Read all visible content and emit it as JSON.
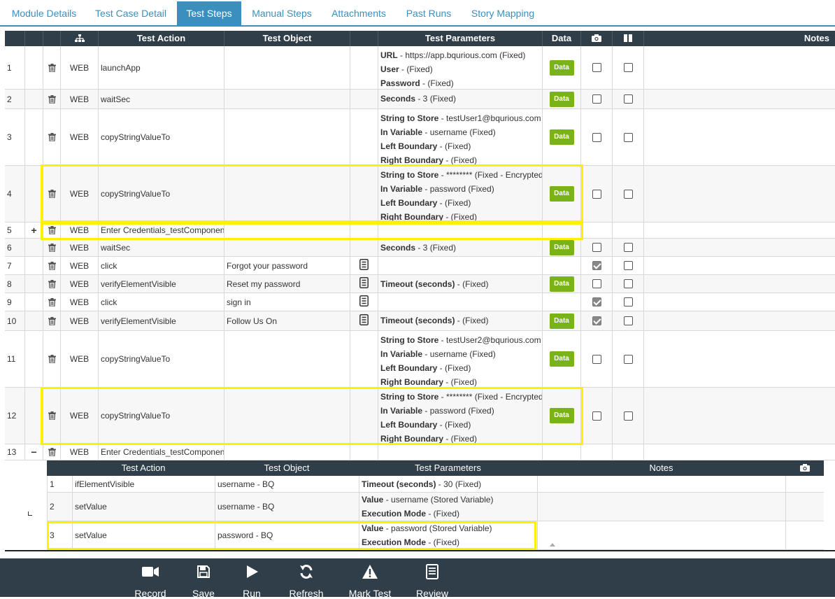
{
  "tabs": [
    {
      "label": "Module Details"
    },
    {
      "label": "Test Case Detail"
    },
    {
      "label": "Test Steps"
    },
    {
      "label": "Manual Steps"
    },
    {
      "label": "Attachments"
    },
    {
      "label": "Past Runs"
    },
    {
      "label": "Story Mapping"
    }
  ],
  "active_tab": "Test Steps",
  "main_table": {
    "headers": {
      "action": "Test Action",
      "object": "Test Object",
      "params": "Test Parameters",
      "data": "Data",
      "notes": "Notes"
    },
    "data_button_label": "Data",
    "rows": [
      {
        "num": "1",
        "expand": "",
        "platform": "WEB",
        "action": "launchApp",
        "object": "",
        "has_obj_icon": false,
        "params": [
          {
            "k": "URL",
            "v": " - https://app.bqurious.com (Fixed)"
          },
          {
            "k": "User",
            "v": " -  (Fixed)"
          },
          {
            "k": "Password",
            "v": " -  (Fixed)"
          }
        ],
        "data": true,
        "cb1": false,
        "cb2": false
      },
      {
        "num": "2",
        "expand": "",
        "platform": "WEB",
        "action": "waitSec",
        "object": "",
        "has_obj_icon": false,
        "params": [
          {
            "k": "Seconds",
            "v": " - 3 (Fixed)"
          }
        ],
        "data": true,
        "cb1": false,
        "cb2": false
      },
      {
        "num": "3",
        "expand": "",
        "platform": "WEB",
        "action": "copyStringValueTo",
        "object": "",
        "has_obj_icon": false,
        "params": [
          {
            "k": "String to Store",
            "v": " - testUser1@bqurious.com"
          },
          {
            "k": "In Variable",
            "v": " - username (Fixed)"
          },
          {
            "k": "Left Boundary",
            "v": " -  (Fixed)"
          },
          {
            "k": "Right Boundary",
            "v": " -  (Fixed)"
          }
        ],
        "data": true,
        "cb1": false,
        "cb2": false
      },
      {
        "num": "4",
        "expand": "",
        "platform": "WEB",
        "action": "copyStringValueTo",
        "object": "",
        "has_obj_icon": false,
        "params": [
          {
            "k": "String to Store",
            "v": " - ******** (Fixed - Encrypted"
          },
          {
            "k": "In Variable",
            "v": " - password (Fixed)"
          },
          {
            "k": "Left Boundary",
            "v": " -  (Fixed)"
          },
          {
            "k": "Right Boundary",
            "v": " -  (Fixed)"
          }
        ],
        "data": true,
        "cb1": false,
        "cb2": false
      },
      {
        "num": "5",
        "expand": "+",
        "platform": "WEB",
        "action": "Enter Credentials_testComponen",
        "object": "",
        "has_obj_icon": false,
        "params": [],
        "data": false,
        "cb1": null,
        "cb2": null
      },
      {
        "num": "6",
        "expand": "",
        "platform": "WEB",
        "action": "waitSec",
        "object": "",
        "has_obj_icon": false,
        "params": [
          {
            "k": "Seconds",
            "v": " - 3 (Fixed)"
          }
        ],
        "data": true,
        "cb1": false,
        "cb2": false
      },
      {
        "num": "7",
        "expand": "",
        "platform": "WEB",
        "action": "click",
        "object": "Forgot your password",
        "has_obj_icon": true,
        "params": [],
        "data": false,
        "cb1": true,
        "cb2": false
      },
      {
        "num": "8",
        "expand": "",
        "platform": "WEB",
        "action": "verifyElementVisible",
        "object": "Reset my password",
        "has_obj_icon": true,
        "params": [
          {
            "k": "Timeout (seconds)",
            "v": " -  (Fixed)"
          }
        ],
        "data": true,
        "cb1": false,
        "cb2": false
      },
      {
        "num": "9",
        "expand": "",
        "platform": "WEB",
        "action": "click",
        "object": "sign in",
        "has_obj_icon": true,
        "params": [],
        "data": false,
        "cb1": true,
        "cb2": false
      },
      {
        "num": "10",
        "expand": "",
        "platform": "WEB",
        "action": "verifyElementVisible",
        "object": "Follow Us On",
        "has_obj_icon": true,
        "params": [
          {
            "k": "Timeout (seconds)",
            "v": " -  (Fixed)"
          }
        ],
        "data": true,
        "cb1": true,
        "cb2": false
      },
      {
        "num": "11",
        "expand": "",
        "platform": "WEB",
        "action": "copyStringValueTo",
        "object": "",
        "has_obj_icon": false,
        "params": [
          {
            "k": "String to Store",
            "v": " - testUser2@bqurious.com"
          },
          {
            "k": "In Variable",
            "v": " - username (Fixed)"
          },
          {
            "k": "Left Boundary",
            "v": " -  (Fixed)"
          },
          {
            "k": "Right Boundary",
            "v": " -  (Fixed)"
          }
        ],
        "data": true,
        "cb1": false,
        "cb2": false
      },
      {
        "num": "12",
        "expand": "",
        "platform": "WEB",
        "action": "copyStringValueTo",
        "object": "",
        "has_obj_icon": false,
        "params": [
          {
            "k": "String to Store",
            "v": " - ******** (Fixed - Encrypted"
          },
          {
            "k": "In Variable",
            "v": " - password (Fixed)"
          },
          {
            "k": "Left Boundary",
            "v": " -  (Fixed)"
          },
          {
            "k": "Right Boundary",
            "v": " -  (Fixed)"
          }
        ],
        "data": true,
        "cb1": false,
        "cb2": false
      },
      {
        "num": "13",
        "expand": "−",
        "platform": "WEB",
        "action": "Enter Credentials_testComponen",
        "object": "",
        "has_obj_icon": false,
        "params": [],
        "data": false,
        "cb1": null,
        "cb2": null
      }
    ]
  },
  "sub_table": {
    "headers": {
      "action": "Test Action",
      "object": "Test Object",
      "params": "Test Parameters",
      "notes": "Notes"
    },
    "rows": [
      {
        "num": "1",
        "action": "ifElementVisible",
        "object": "username  - BQ",
        "params": [
          {
            "k": "Timeout (seconds)",
            "v": " - 30 (Fixed)"
          }
        ]
      },
      {
        "num": "2",
        "action": "setValue",
        "object": "username  - BQ",
        "params": [
          {
            "k": "Value",
            "v": " - username (Stored Variable)"
          },
          {
            "k": "Execution Mode",
            "v": " -  (Fixed)"
          }
        ]
      },
      {
        "num": "3",
        "action": "setValue",
        "object": "password - BQ",
        "params": [
          {
            "k": "Value",
            "v": " - password (Stored Variable)"
          },
          {
            "k": "Execution Mode",
            "v": " -  (Fixed)"
          }
        ]
      }
    ]
  },
  "footer": {
    "buttons": [
      {
        "label": "Record",
        "icon": "video-camera-icon"
      },
      {
        "label": "Save",
        "icon": "floppy-disk-icon"
      },
      {
        "label": "Run",
        "icon": "play-icon"
      },
      {
        "label": "Refresh",
        "icon": "refresh-icon"
      },
      {
        "label": "Mark Test",
        "icon": "warning-icon"
      },
      {
        "label": "Review",
        "icon": "document-icon"
      }
    ]
  },
  "colors": {
    "tab_accent": "#3a8fbf",
    "header_bg": "#2f3e48",
    "data_button": "#7ab317",
    "highlight": "#fff200"
  }
}
